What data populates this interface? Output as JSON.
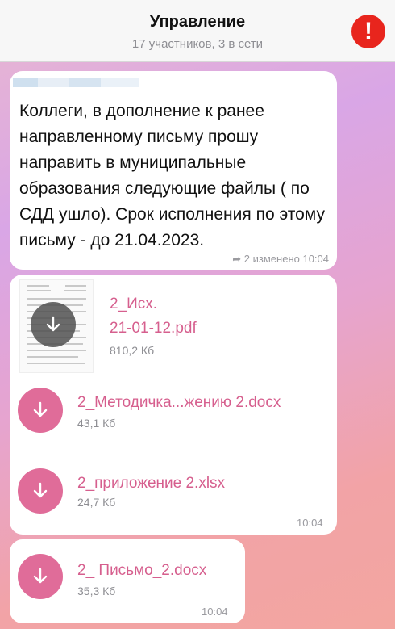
{
  "header": {
    "title": "Управление",
    "subtitle": "17 участников, 3 в сети",
    "alert_glyph": "!"
  },
  "message": {
    "text": "Коллеги, в дополнение к ранее направленному письму прошу направить в муниципальные образования следующие файлы ( по СДД ушло). Срок исполнения по этому письму - до 21.04.2023.",
    "meta": "2 изменено 10:04",
    "reply_icon": "reply-icon"
  },
  "files_bubble": {
    "time": "10:04",
    "files": [
      {
        "name_line1": "2_Исх.",
        "name_line2": "21-01-12.pdf",
        "size": "810,2 Кб"
      },
      {
        "name": "2_Методичка...жению 2.docx",
        "size": "43,1 Кб"
      },
      {
        "name": "2_приложение 2.xlsx",
        "size": "24,7 Кб"
      }
    ]
  },
  "last_bubble": {
    "name": "2_ Письмо_2.docx",
    "size": "35,3 Кб",
    "time": "10:04"
  },
  "colors": {
    "accent": "#d65f8e",
    "download_button": "#e06c99",
    "alert": "#e8251d"
  }
}
